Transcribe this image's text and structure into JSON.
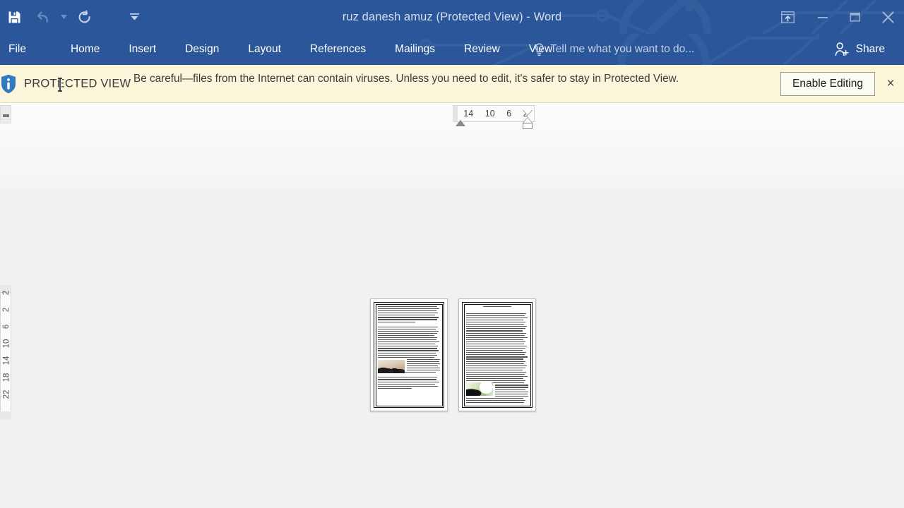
{
  "window": {
    "title": "ruz danesh amuz (Protected View) - Word",
    "accent_color": "#2b579a",
    "quick_access": [
      {
        "name": "save",
        "icon": "save-icon",
        "label": "Save",
        "enabled": true
      },
      {
        "name": "undo",
        "icon": "undo-icon",
        "label": "Undo",
        "enabled": false
      },
      {
        "name": "undo-dropdown",
        "icon": "chevron-down-icon",
        "label": "Undo options",
        "enabled": false
      },
      {
        "name": "repeat",
        "icon": "redo-icon",
        "label": "Repeat",
        "enabled": true
      },
      {
        "name": "customize-qat",
        "icon": "chevron-down-icon",
        "label": "Customize Quick Access Toolbar",
        "enabled": true
      }
    ],
    "controls": [
      {
        "name": "ribbon-display-options",
        "icon": "ribbon-display-icon",
        "label": "Ribbon Display Options"
      },
      {
        "name": "minimize",
        "icon": "minimize-icon",
        "label": "Minimize"
      },
      {
        "name": "restore",
        "icon": "restore-icon",
        "label": "Restore Down"
      },
      {
        "name": "close",
        "icon": "close-icon",
        "label": "Close"
      }
    ]
  },
  "ribbon": {
    "tabs": [
      {
        "id": "file",
        "label": "File"
      },
      {
        "id": "home",
        "label": "Home"
      },
      {
        "id": "insert",
        "label": "Insert"
      },
      {
        "id": "design",
        "label": "Design"
      },
      {
        "id": "layout",
        "label": "Layout"
      },
      {
        "id": "references",
        "label": "References"
      },
      {
        "id": "mailings",
        "label": "Mailings"
      },
      {
        "id": "review",
        "label": "Review"
      },
      {
        "id": "view",
        "label": "View"
      }
    ],
    "tell_me": {
      "icon": "lightbulb-icon",
      "placeholder": "Tell me what you want to do..."
    },
    "share": {
      "icon": "person-add-icon",
      "label": "Share"
    }
  },
  "protected_view": {
    "icon": "info-shield-icon",
    "title": "PROTECTED VIEW",
    "message": "Be careful—files from the Internet can contain viruses. Unless you need to edit, it's safer to stay in Protected View.",
    "enable_button": "Enable Editing",
    "close_label": "×",
    "background_color": "#fbf6d9"
  },
  "rulers": {
    "horizontal": {
      "unit_marks": [
        "14",
        "10",
        "6",
        "2"
      ],
      "direction": "rtl",
      "indent_markers": [
        "first-line-indent",
        "hanging-indent",
        "left-indent"
      ]
    },
    "vertical": {
      "unit_marks": [
        "2",
        "2",
        "6",
        "10",
        "14",
        "18",
        "22"
      ]
    }
  },
  "document": {
    "view_mode": "multiple-pages",
    "pages": [
      {
        "number": 1,
        "has_border_frame": true,
        "has_title_line": false,
        "image": {
          "name": "crowd-photo",
          "position": "left",
          "row": 14
        },
        "line_count": 40
      },
      {
        "number": 2,
        "has_border_frame": true,
        "has_title_line": true,
        "image": {
          "name": "people-green-photo",
          "position": "left",
          "row": 24
        },
        "line_count": 46
      }
    ]
  }
}
